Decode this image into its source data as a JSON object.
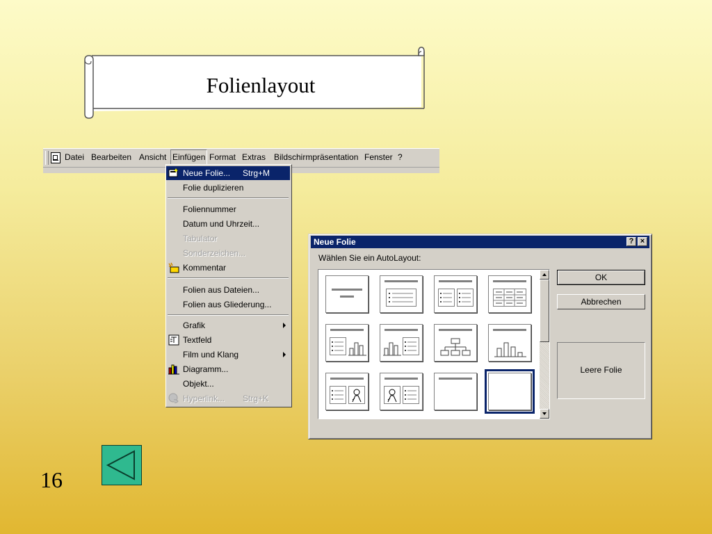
{
  "slide": {
    "title": "Folienlayout",
    "number": "16"
  },
  "menubar": {
    "items": [
      "Datei",
      "Bearbeiten",
      "Ansicht",
      "Einfügen",
      "Format",
      "Extras",
      "Bildschirmpräsentation",
      "Fenster",
      "?"
    ]
  },
  "dropdown": {
    "items": [
      {
        "label": "Neue Folie...",
        "shortcut": "Strg+M",
        "state": "highlighted",
        "icon": "new-slide-icon"
      },
      {
        "label": "Folie duplizieren"
      },
      {
        "label": "Foliennummer"
      },
      {
        "label": "Datum und Uhrzeit..."
      },
      {
        "label": "Tabulator",
        "state": "disabled"
      },
      {
        "label": "Sonderzeichen...",
        "state": "disabled"
      },
      {
        "label": "Kommentar",
        "icon": "comment-icon"
      },
      {
        "label": "Folien aus Dateien..."
      },
      {
        "label": "Folien aus Gliederung..."
      },
      {
        "label": "Grafik",
        "submenu": true
      },
      {
        "label": "Textfeld",
        "icon": "textbox-icon"
      },
      {
        "label": "Film und Klang",
        "submenu": true
      },
      {
        "label": "Diagramm...",
        "icon": "chart-icon"
      },
      {
        "label": "Objekt..."
      },
      {
        "label": "Hyperlink...",
        "shortcut": "Strg+K",
        "state": "disabled",
        "icon": "hyperlink-icon"
      }
    ]
  },
  "dialog": {
    "title": "Neue Folie",
    "help_button": "?",
    "close_button": "×",
    "prompt": "Wählen Sie ein AutoLayout:",
    "ok_label": "OK",
    "cancel_label": "Abbrechen",
    "preview_label": "Leere Folie",
    "selected_layout": "Leere Folie"
  },
  "colors": {
    "selection": "#0a246a",
    "dialog_face": "#d4d0c8",
    "back_button": "#2fb98f",
    "back_arrow": "#0a5a3c"
  },
  "icons": {
    "back": "back-arrow-icon"
  }
}
